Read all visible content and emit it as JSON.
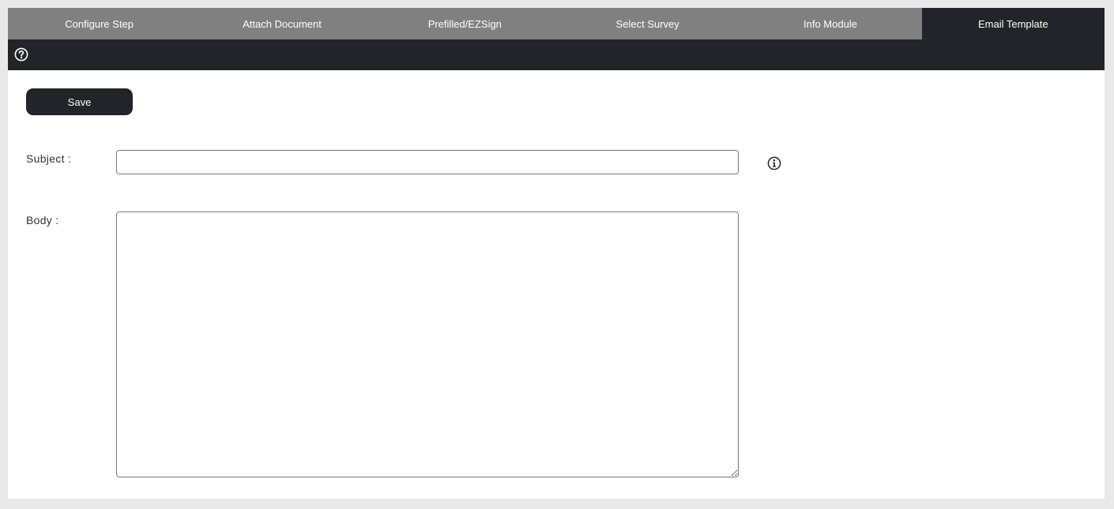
{
  "tabs": [
    {
      "label": "Configure Step",
      "active": false
    },
    {
      "label": "Attach Document",
      "active": false
    },
    {
      "label": "Prefilled/EZSign",
      "active": false
    },
    {
      "label": "Select Survey",
      "active": false
    },
    {
      "label": "Info Module",
      "active": false
    },
    {
      "label": "Email Template",
      "active": true
    }
  ],
  "toolbar": {
    "help_icon": "question-circle-icon"
  },
  "form": {
    "save_label": "Save",
    "subject": {
      "label": "Subject :",
      "value": "",
      "info_icon": "info-circle-icon"
    },
    "body": {
      "label": "Body :",
      "value": ""
    }
  },
  "colors": {
    "tab_bar": "#808080",
    "active_tab": "#212529",
    "toolbar": "#212529",
    "button": "#212529",
    "page_bg": "#e9e9e9"
  }
}
